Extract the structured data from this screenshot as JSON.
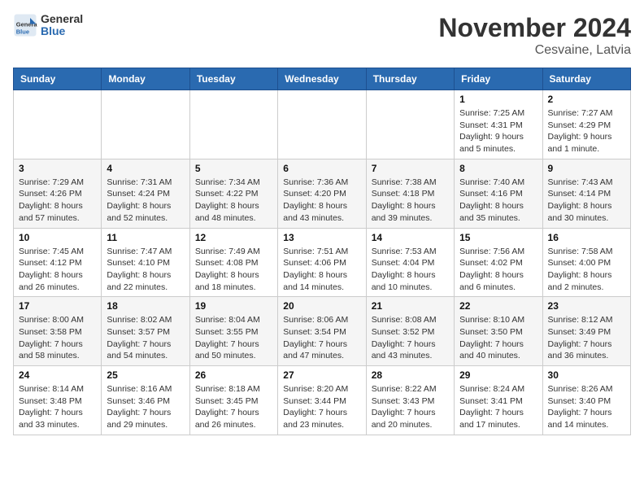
{
  "logo": {
    "general": "General",
    "blue": "Blue"
  },
  "title": "November 2024",
  "location": "Cesvaine, Latvia",
  "days_header": [
    "Sunday",
    "Monday",
    "Tuesday",
    "Wednesday",
    "Thursday",
    "Friday",
    "Saturday"
  ],
  "weeks": [
    [
      {
        "day": "",
        "info": ""
      },
      {
        "day": "",
        "info": ""
      },
      {
        "day": "",
        "info": ""
      },
      {
        "day": "",
        "info": ""
      },
      {
        "day": "",
        "info": ""
      },
      {
        "day": "1",
        "info": "Sunrise: 7:25 AM\nSunset: 4:31 PM\nDaylight: 9 hours\nand 5 minutes."
      },
      {
        "day": "2",
        "info": "Sunrise: 7:27 AM\nSunset: 4:29 PM\nDaylight: 9 hours\nand 1 minute."
      }
    ],
    [
      {
        "day": "3",
        "info": "Sunrise: 7:29 AM\nSunset: 4:26 PM\nDaylight: 8 hours\nand 57 minutes."
      },
      {
        "day": "4",
        "info": "Sunrise: 7:31 AM\nSunset: 4:24 PM\nDaylight: 8 hours\nand 52 minutes."
      },
      {
        "day": "5",
        "info": "Sunrise: 7:34 AM\nSunset: 4:22 PM\nDaylight: 8 hours\nand 48 minutes."
      },
      {
        "day": "6",
        "info": "Sunrise: 7:36 AM\nSunset: 4:20 PM\nDaylight: 8 hours\nand 43 minutes."
      },
      {
        "day": "7",
        "info": "Sunrise: 7:38 AM\nSunset: 4:18 PM\nDaylight: 8 hours\nand 39 minutes."
      },
      {
        "day": "8",
        "info": "Sunrise: 7:40 AM\nSunset: 4:16 PM\nDaylight: 8 hours\nand 35 minutes."
      },
      {
        "day": "9",
        "info": "Sunrise: 7:43 AM\nSunset: 4:14 PM\nDaylight: 8 hours\nand 30 minutes."
      }
    ],
    [
      {
        "day": "10",
        "info": "Sunrise: 7:45 AM\nSunset: 4:12 PM\nDaylight: 8 hours\nand 26 minutes."
      },
      {
        "day": "11",
        "info": "Sunrise: 7:47 AM\nSunset: 4:10 PM\nDaylight: 8 hours\nand 22 minutes."
      },
      {
        "day": "12",
        "info": "Sunrise: 7:49 AM\nSunset: 4:08 PM\nDaylight: 8 hours\nand 18 minutes."
      },
      {
        "day": "13",
        "info": "Sunrise: 7:51 AM\nSunset: 4:06 PM\nDaylight: 8 hours\nand 14 minutes."
      },
      {
        "day": "14",
        "info": "Sunrise: 7:53 AM\nSunset: 4:04 PM\nDaylight: 8 hours\nand 10 minutes."
      },
      {
        "day": "15",
        "info": "Sunrise: 7:56 AM\nSunset: 4:02 PM\nDaylight: 8 hours\nand 6 minutes."
      },
      {
        "day": "16",
        "info": "Sunrise: 7:58 AM\nSunset: 4:00 PM\nDaylight: 8 hours\nand 2 minutes."
      }
    ],
    [
      {
        "day": "17",
        "info": "Sunrise: 8:00 AM\nSunset: 3:58 PM\nDaylight: 7 hours\nand 58 minutes."
      },
      {
        "day": "18",
        "info": "Sunrise: 8:02 AM\nSunset: 3:57 PM\nDaylight: 7 hours\nand 54 minutes."
      },
      {
        "day": "19",
        "info": "Sunrise: 8:04 AM\nSunset: 3:55 PM\nDaylight: 7 hours\nand 50 minutes."
      },
      {
        "day": "20",
        "info": "Sunrise: 8:06 AM\nSunset: 3:54 PM\nDaylight: 7 hours\nand 47 minutes."
      },
      {
        "day": "21",
        "info": "Sunrise: 8:08 AM\nSunset: 3:52 PM\nDaylight: 7 hours\nand 43 minutes."
      },
      {
        "day": "22",
        "info": "Sunrise: 8:10 AM\nSunset: 3:50 PM\nDaylight: 7 hours\nand 40 minutes."
      },
      {
        "day": "23",
        "info": "Sunrise: 8:12 AM\nSunset: 3:49 PM\nDaylight: 7 hours\nand 36 minutes."
      }
    ],
    [
      {
        "day": "24",
        "info": "Sunrise: 8:14 AM\nSunset: 3:48 PM\nDaylight: 7 hours\nand 33 minutes."
      },
      {
        "day": "25",
        "info": "Sunrise: 8:16 AM\nSunset: 3:46 PM\nDaylight: 7 hours\nand 29 minutes."
      },
      {
        "day": "26",
        "info": "Sunrise: 8:18 AM\nSunset: 3:45 PM\nDaylight: 7 hours\nand 26 minutes."
      },
      {
        "day": "27",
        "info": "Sunrise: 8:20 AM\nSunset: 3:44 PM\nDaylight: 7 hours\nand 23 minutes."
      },
      {
        "day": "28",
        "info": "Sunrise: 8:22 AM\nSunset: 3:43 PM\nDaylight: 7 hours\nand 20 minutes."
      },
      {
        "day": "29",
        "info": "Sunrise: 8:24 AM\nSunset: 3:41 PM\nDaylight: 7 hours\nand 17 minutes."
      },
      {
        "day": "30",
        "info": "Sunrise: 8:26 AM\nSunset: 3:40 PM\nDaylight: 7 hours\nand 14 minutes."
      }
    ]
  ]
}
